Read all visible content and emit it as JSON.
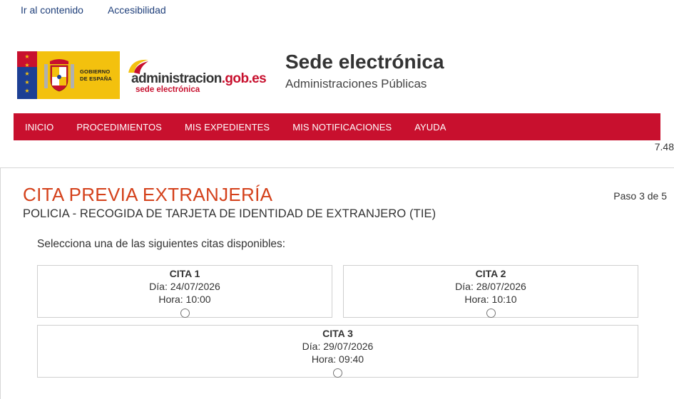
{
  "skip_links": [
    "Ir al contenido",
    "Accesibilidad"
  ],
  "logo": {
    "gov_line1": "GOBIERNO",
    "gov_line2": "DE ESPAÑA",
    "adm_main": "administracion",
    "adm_domain": ".gob.es",
    "adm_sede": "sede electrónica"
  },
  "header": {
    "title": "Sede electrónica",
    "subtitle": "Administraciones Públicas"
  },
  "nav": {
    "items": [
      "INICIO",
      "PROCEDIMIENTOS",
      "MIS EXPEDIENTES",
      "MIS NOTIFICACIONES",
      "AYUDA"
    ]
  },
  "version": "7.48",
  "main": {
    "title": "CITA PREVIA EXTRANJERÍA",
    "subtitle": "POLICIA - RECOGIDA DE TARJETA DE IDENTIDAD DE EXTRANJERO (TIE)",
    "step": "Paso 3 de 5",
    "instruction": "Selecciona una de las siguientes citas disponibles:",
    "citas": [
      {
        "title": "CITA 1",
        "day": "Día: 24/07/2026",
        "time": "Hora: 10:00"
      },
      {
        "title": "CITA 2",
        "day": "Día: 28/07/2026",
        "time": "Hora: 10:10"
      },
      {
        "title": "CITA 3",
        "day": "Día: 29/07/2026",
        "time": "Hora: 09:40"
      }
    ]
  },
  "colors": {
    "nav_bg": "#c8102e",
    "title_red": "#d4411b",
    "link_blue": "#1f3f7a",
    "gov_yellow": "#f3c10e"
  }
}
